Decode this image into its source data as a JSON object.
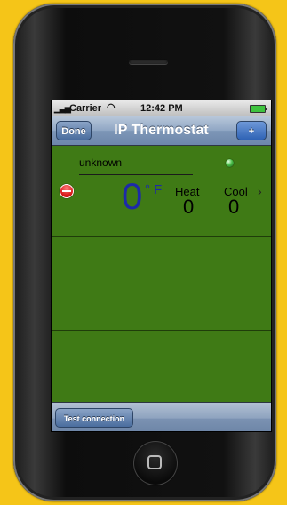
{
  "colors": {
    "background": "#f5c518",
    "screen_green": "#3f7a15",
    "temperature_blue": "#1d2aa8",
    "navbar_blue": "#7d96b7"
  },
  "status_bar": {
    "signal_icon": "signal-bars-icon",
    "carrier": "Carrier",
    "wifi_icon": "wifi-icon",
    "time": "12:42 PM",
    "battery_icon": "battery-icon"
  },
  "navbar": {
    "title": "IP Thermostat",
    "left_button": "Done",
    "right_button": "+"
  },
  "thermostat": {
    "name": "unknown",
    "status_light": "green",
    "temperature": "0",
    "unit": "° F",
    "heat_label": "Heat",
    "heat_value": "0",
    "cool_label": "Cool",
    "cool_value": "0",
    "chevron": "›"
  },
  "toolbar": {
    "test_button": "Test connection"
  }
}
